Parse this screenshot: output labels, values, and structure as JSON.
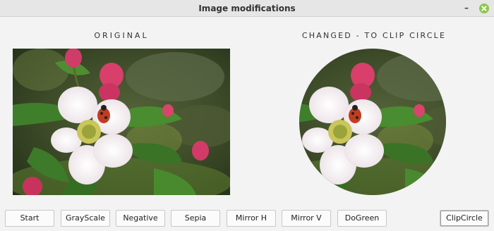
{
  "window": {
    "title": "Image modifications"
  },
  "labels": {
    "original": "ORIGINAL",
    "changed": "CHANGED - TO CLIP CIRCLE"
  },
  "buttons": {
    "start": "Start",
    "grayscale": "GrayScale",
    "negative": "Negative",
    "sepia": "Sepia",
    "mirror_h": "Mirror H",
    "mirror_v": "Mirror V",
    "dogreen": "DoGreen",
    "clipcircle": "ClipCircle"
  },
  "colors": {
    "close_button": "#8cc74c",
    "petal": "#f4f0f0",
    "bud": "#d83f6a",
    "leaf": "#3f7f2c"
  }
}
